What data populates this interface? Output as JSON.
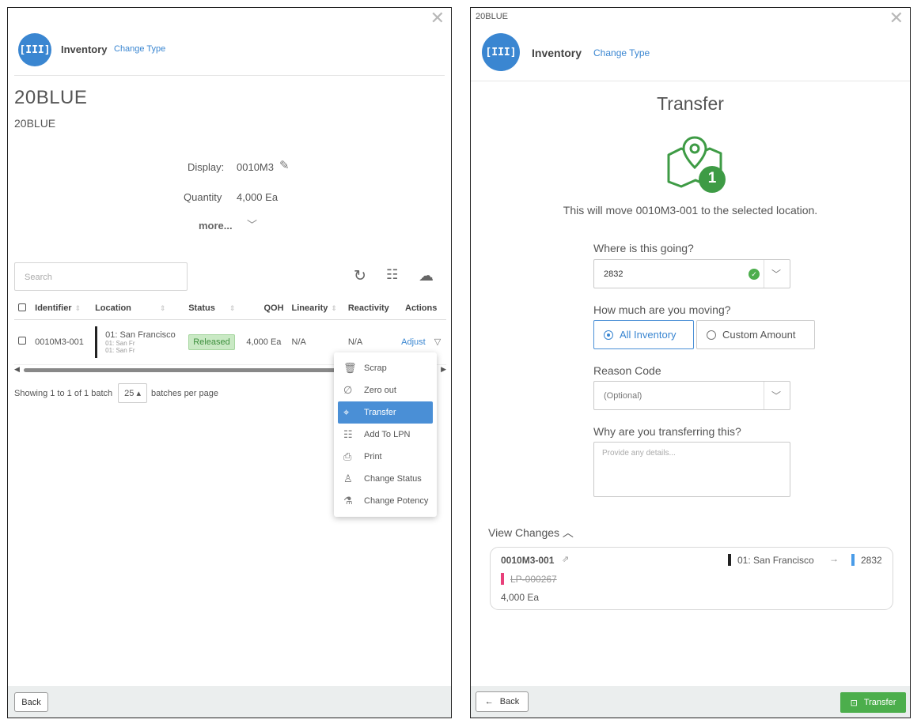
{
  "left": {
    "header": {
      "title": "Inventory",
      "change_type": "Change Type",
      "icon": "barcode-scan-icon"
    },
    "item": {
      "title": "20BLUE",
      "subtitle": "20BLUE"
    },
    "details": {
      "display_label": "Display:",
      "display_value": "0010M3",
      "quantity_label": "Quantity",
      "quantity_value": "4,000 Ea",
      "more_label": "more..."
    },
    "search": {
      "placeholder": "Search"
    },
    "table": {
      "columns": [
        "Identifier",
        "Location",
        "Status",
        "QOH",
        "Linearity",
        "Reactivity",
        "Actions"
      ],
      "rows": [
        {
          "identifier": "0010M3-001",
          "location": "01: San Francisco",
          "location_sub1": "01: San Fr",
          "location_sub2": "01: San Fr",
          "status": "Released",
          "qoh": "4,000 Ea",
          "linearity": "N/A",
          "reactivity": "N/A",
          "action": "Adjust"
        }
      ]
    },
    "pagination": {
      "showing": "Showing 1 to 1 of 1 batch",
      "page_size": "25",
      "per_page_label": "batches per page"
    },
    "menu": {
      "items": [
        {
          "label": "Scrap",
          "icon": "trash-icon"
        },
        {
          "label": "Zero out",
          "icon": "empty-set-icon"
        },
        {
          "label": "Transfer",
          "icon": "map-icon"
        },
        {
          "label": "Add To LPN",
          "icon": "lpn-icon"
        },
        {
          "label": "Print",
          "icon": "printer-icon"
        },
        {
          "label": "Change Status",
          "icon": "stamp-icon"
        },
        {
          "label": "Change Potency",
          "icon": "flask-icon"
        }
      ],
      "active_index": 2
    },
    "footer": {
      "back_label": "Back"
    }
  },
  "right": {
    "top_label": "20BLUE",
    "header": {
      "title": "Inventory",
      "change_type": "Change Type"
    },
    "transfer": {
      "title": "Transfer",
      "badge_count": "1",
      "info": "This will move 0010M3-001 to the selected location.",
      "where_label": "Where is this going?",
      "where_value": "2832",
      "how_much_label": "How much are you moving?",
      "option_all": "All Inventory",
      "option_custom": "Custom Amount",
      "reason_label": "Reason Code",
      "reason_placeholder": "(Optional)",
      "why_label": "Why are you transferring this?",
      "why_placeholder": "Provide any details..."
    },
    "changes": {
      "toggle_label": "View Changes",
      "identifier": "0010M3-001",
      "from_location": "01: San Francisco",
      "to_location": "2832",
      "lpn": "LP-000267",
      "quantity": "4,000 Ea"
    },
    "footer": {
      "back_label": "Back",
      "transfer_label": "Transfer"
    }
  },
  "colors": {
    "accent": "#3a86d1",
    "success": "#4cae4c",
    "menu_active": "#4a8fd6",
    "lpn_tag": "#e8407a",
    "to_location": "#4a9ce8"
  }
}
